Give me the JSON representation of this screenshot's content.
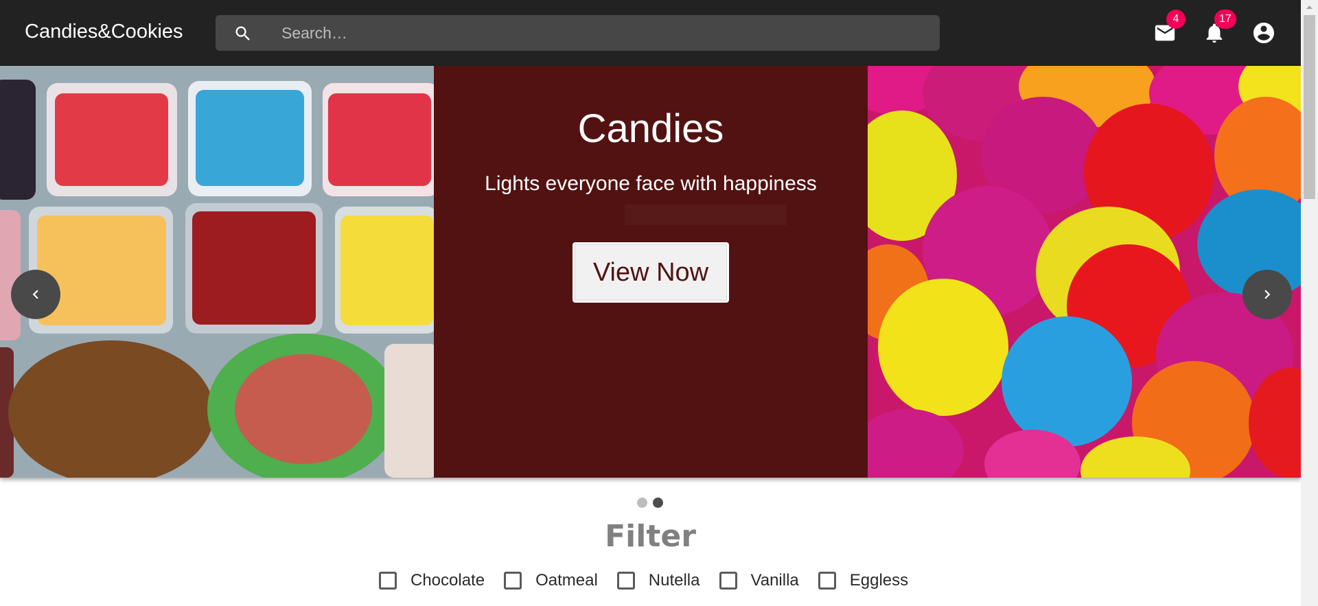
{
  "header": {
    "brand": "Candies&Cookies",
    "search_placeholder": "Search…",
    "mail_badge": "4",
    "notifications_badge": "17",
    "icons": {
      "search": "search-icon",
      "mail": "mail-icon",
      "notifications": "bell-icon",
      "account": "account-circle-icon"
    }
  },
  "carousel": {
    "title": "Candies",
    "subtitle": "Lights everyone face with happiness",
    "cta_label": "View Now",
    "active_slide": 2,
    "slide_count": 2,
    "colors": {
      "panel_bg": "#531212",
      "cta_text": "#531212"
    }
  },
  "filter": {
    "title": "Filter",
    "options": [
      {
        "label": "Chocolate",
        "checked": false
      },
      {
        "label": "Oatmeal",
        "checked": false
      },
      {
        "label": "Nutella",
        "checked": false
      },
      {
        "label": "Vanilla",
        "checked": false
      },
      {
        "label": "Eggless",
        "checked": false
      }
    ]
  },
  "colors": {
    "appbar": "#222222",
    "badge": "#f50057",
    "filter_title": "#808080"
  }
}
